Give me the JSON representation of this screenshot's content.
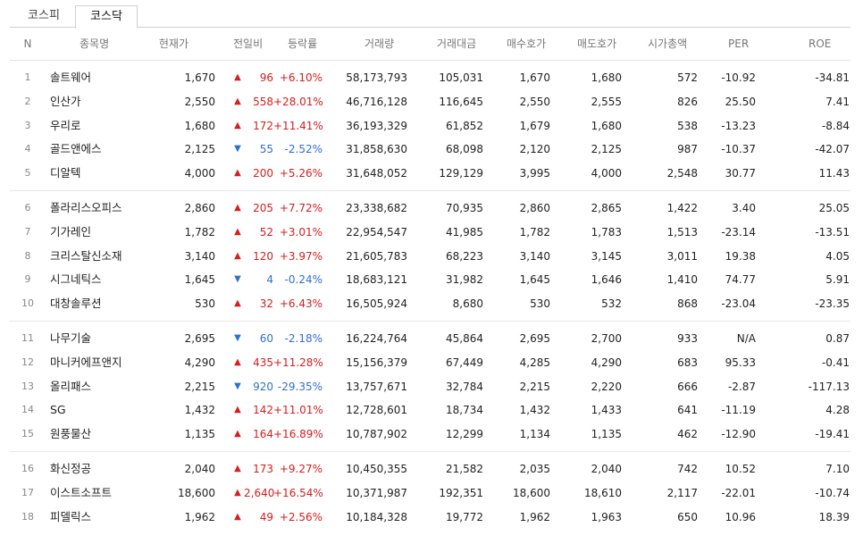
{
  "tabs": [
    {
      "label": "코스피",
      "active": false
    },
    {
      "label": "코스닥",
      "active": true
    }
  ],
  "columns": {
    "n": "N",
    "name": "종목명",
    "price": "현재가",
    "change": "전일비",
    "rate": "등락률",
    "volume": "거래량",
    "amount": "거래대금",
    "bid": "매수호가",
    "ask": "매도호가",
    "cap": "시가총액",
    "per": "PER",
    "roe": "ROE"
  },
  "colors": {
    "up": "#d51e1e",
    "down": "#2f6fd4"
  },
  "groups": [
    [
      {
        "n": "1",
        "name": "솔트웨어",
        "price": "1,670",
        "dir": "up",
        "change": "96",
        "rate": "+6.10%",
        "volume": "58,173,793",
        "amount": "105,031",
        "bid": "1,670",
        "ask": "1,680",
        "cap": "572",
        "per": "-10.92",
        "roe": "-34.81"
      },
      {
        "n": "2",
        "name": "인산가",
        "price": "2,550",
        "dir": "up",
        "change": "558",
        "rate": "+28.01%",
        "volume": "46,716,128",
        "amount": "116,645",
        "bid": "2,550",
        "ask": "2,555",
        "cap": "826",
        "per": "25.50",
        "roe": "7.41"
      },
      {
        "n": "3",
        "name": "우리로",
        "price": "1,680",
        "dir": "up",
        "change": "172",
        "rate": "+11.41%",
        "volume": "36,193,329",
        "amount": "61,852",
        "bid": "1,679",
        "ask": "1,680",
        "cap": "538",
        "per": "-13.23",
        "roe": "-8.84"
      },
      {
        "n": "4",
        "name": "골드앤에스",
        "price": "2,125",
        "dir": "down",
        "change": "55",
        "rate": "-2.52%",
        "volume": "31,858,630",
        "amount": "68,098",
        "bid": "2,120",
        "ask": "2,125",
        "cap": "987",
        "per": "-10.37",
        "roe": "-42.07"
      },
      {
        "n": "5",
        "name": "디알텍",
        "price": "4,000",
        "dir": "up",
        "change": "200",
        "rate": "+5.26%",
        "volume": "31,648,052",
        "amount": "129,129",
        "bid": "3,995",
        "ask": "4,000",
        "cap": "2,548",
        "per": "30.77",
        "roe": "11.43"
      }
    ],
    [
      {
        "n": "6",
        "name": "폴라리스오피스",
        "price": "2,860",
        "dir": "up",
        "change": "205",
        "rate": "+7.72%",
        "volume": "23,338,682",
        "amount": "70,935",
        "bid": "2,860",
        "ask": "2,865",
        "cap": "1,422",
        "per": "3.40",
        "roe": "25.05"
      },
      {
        "n": "7",
        "name": "기가레인",
        "price": "1,782",
        "dir": "up",
        "change": "52",
        "rate": "+3.01%",
        "volume": "22,954,547",
        "amount": "41,985",
        "bid": "1,782",
        "ask": "1,783",
        "cap": "1,513",
        "per": "-23.14",
        "roe": "-13.51"
      },
      {
        "n": "8",
        "name": "크리스탈신소재",
        "price": "3,140",
        "dir": "up",
        "change": "120",
        "rate": "+3.97%",
        "volume": "21,605,783",
        "amount": "68,223",
        "bid": "3,140",
        "ask": "3,145",
        "cap": "3,011",
        "per": "19.38",
        "roe": "4.05"
      },
      {
        "n": "9",
        "name": "시그네틱스",
        "price": "1,645",
        "dir": "down",
        "change": "4",
        "rate": "-0.24%",
        "volume": "18,683,121",
        "amount": "31,982",
        "bid": "1,645",
        "ask": "1,646",
        "cap": "1,410",
        "per": "74.77",
        "roe": "5.91"
      },
      {
        "n": "10",
        "name": "대창솔루션",
        "price": "530",
        "dir": "up",
        "change": "32",
        "rate": "+6.43%",
        "volume": "16,505,924",
        "amount": "8,680",
        "bid": "530",
        "ask": "532",
        "cap": "868",
        "per": "-23.04",
        "roe": "-23.35"
      }
    ],
    [
      {
        "n": "11",
        "name": "나무기술",
        "price": "2,695",
        "dir": "down",
        "change": "60",
        "rate": "-2.18%",
        "volume": "16,224,764",
        "amount": "45,864",
        "bid": "2,695",
        "ask": "2,700",
        "cap": "933",
        "per": "N/A",
        "roe": "0.87"
      },
      {
        "n": "12",
        "name": "마니커에프앤지",
        "price": "4,290",
        "dir": "up",
        "change": "435",
        "rate": "+11.28%",
        "volume": "15,156,379",
        "amount": "67,449",
        "bid": "4,285",
        "ask": "4,290",
        "cap": "683",
        "per": "95.33",
        "roe": "-0.41"
      },
      {
        "n": "13",
        "name": "올리패스",
        "price": "2,215",
        "dir": "down",
        "change": "920",
        "rate": "-29.35%",
        "volume": "13,757,671",
        "amount": "32,784",
        "bid": "2,215",
        "ask": "2,220",
        "cap": "666",
        "per": "-2.87",
        "roe": "-117.13"
      },
      {
        "n": "14",
        "name": "SG",
        "price": "1,432",
        "dir": "up",
        "change": "142",
        "rate": "+11.01%",
        "volume": "12,728,601",
        "amount": "18,734",
        "bid": "1,432",
        "ask": "1,433",
        "cap": "641",
        "per": "-11.19",
        "roe": "4.28"
      },
      {
        "n": "15",
        "name": "원풍물산",
        "price": "1,135",
        "dir": "up",
        "change": "164",
        "rate": "+16.89%",
        "volume": "10,787,902",
        "amount": "12,299",
        "bid": "1,134",
        "ask": "1,135",
        "cap": "462",
        "per": "-12.90",
        "roe": "-19.41"
      }
    ],
    [
      {
        "n": "16",
        "name": "화신정공",
        "price": "2,040",
        "dir": "up",
        "change": "173",
        "rate": "+9.27%",
        "volume": "10,450,355",
        "amount": "21,582",
        "bid": "2,035",
        "ask": "2,040",
        "cap": "742",
        "per": "10.52",
        "roe": "7.10"
      },
      {
        "n": "17",
        "name": "이스트소프트",
        "price": "18,600",
        "dir": "up",
        "change": "2,640",
        "rate": "+16.54%",
        "volume": "10,371,987",
        "amount": "192,351",
        "bid": "18,600",
        "ask": "18,610",
        "cap": "2,117",
        "per": "-22.01",
        "roe": "-10.74"
      },
      {
        "n": "18",
        "name": "피델릭스",
        "price": "1,962",
        "dir": "up",
        "change": "49",
        "rate": "+2.56%",
        "volume": "10,184,328",
        "amount": "19,772",
        "bid": "1,962",
        "ask": "1,963",
        "cap": "650",
        "per": "10.96",
        "roe": "18.39"
      }
    ]
  ]
}
